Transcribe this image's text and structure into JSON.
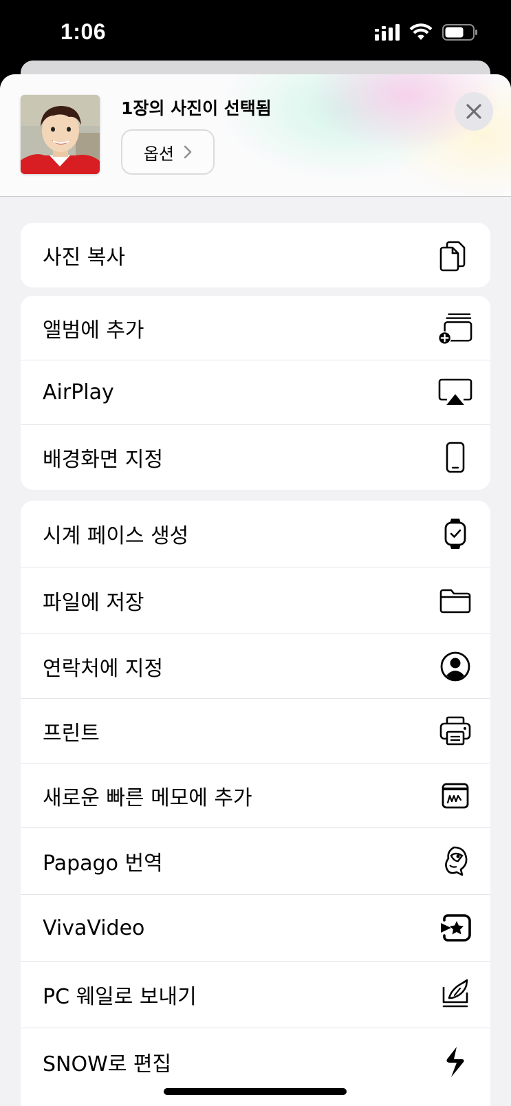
{
  "status_bar": {
    "time": "1:06"
  },
  "sheet_header": {
    "title": "1장의 사진이 선택됨",
    "options_label": "옵션"
  },
  "groups": [
    {
      "items": [
        {
          "label": "사진 복사",
          "icon": "copy-icon"
        }
      ]
    },
    {
      "items": [
        {
          "label": "앨범에 추가",
          "icon": "add-to-album-icon"
        },
        {
          "label": "AirPlay",
          "icon": "airplay-icon"
        },
        {
          "label": "배경화면 지정",
          "icon": "iphone-icon"
        }
      ]
    },
    {
      "items": [
        {
          "label": "시계 페이스 생성",
          "icon": "watch-icon"
        },
        {
          "label": "파일에 저장",
          "icon": "folder-icon"
        },
        {
          "label": "연락처에 지정",
          "icon": "contact-icon"
        },
        {
          "label": "프린트",
          "icon": "printer-icon"
        },
        {
          "label": "새로운 빠른 메모에 추가",
          "icon": "quick-note-icon"
        },
        {
          "label": "Papago 번역",
          "icon": "papago-icon"
        },
        {
          "label": "VivaVideo",
          "icon": "vivavideo-icon"
        },
        {
          "label": "PC 웨일로 보내기",
          "icon": "whale-icon"
        },
        {
          "label": "SNOW로 편집",
          "icon": "snow-icon"
        }
      ]
    }
  ]
}
